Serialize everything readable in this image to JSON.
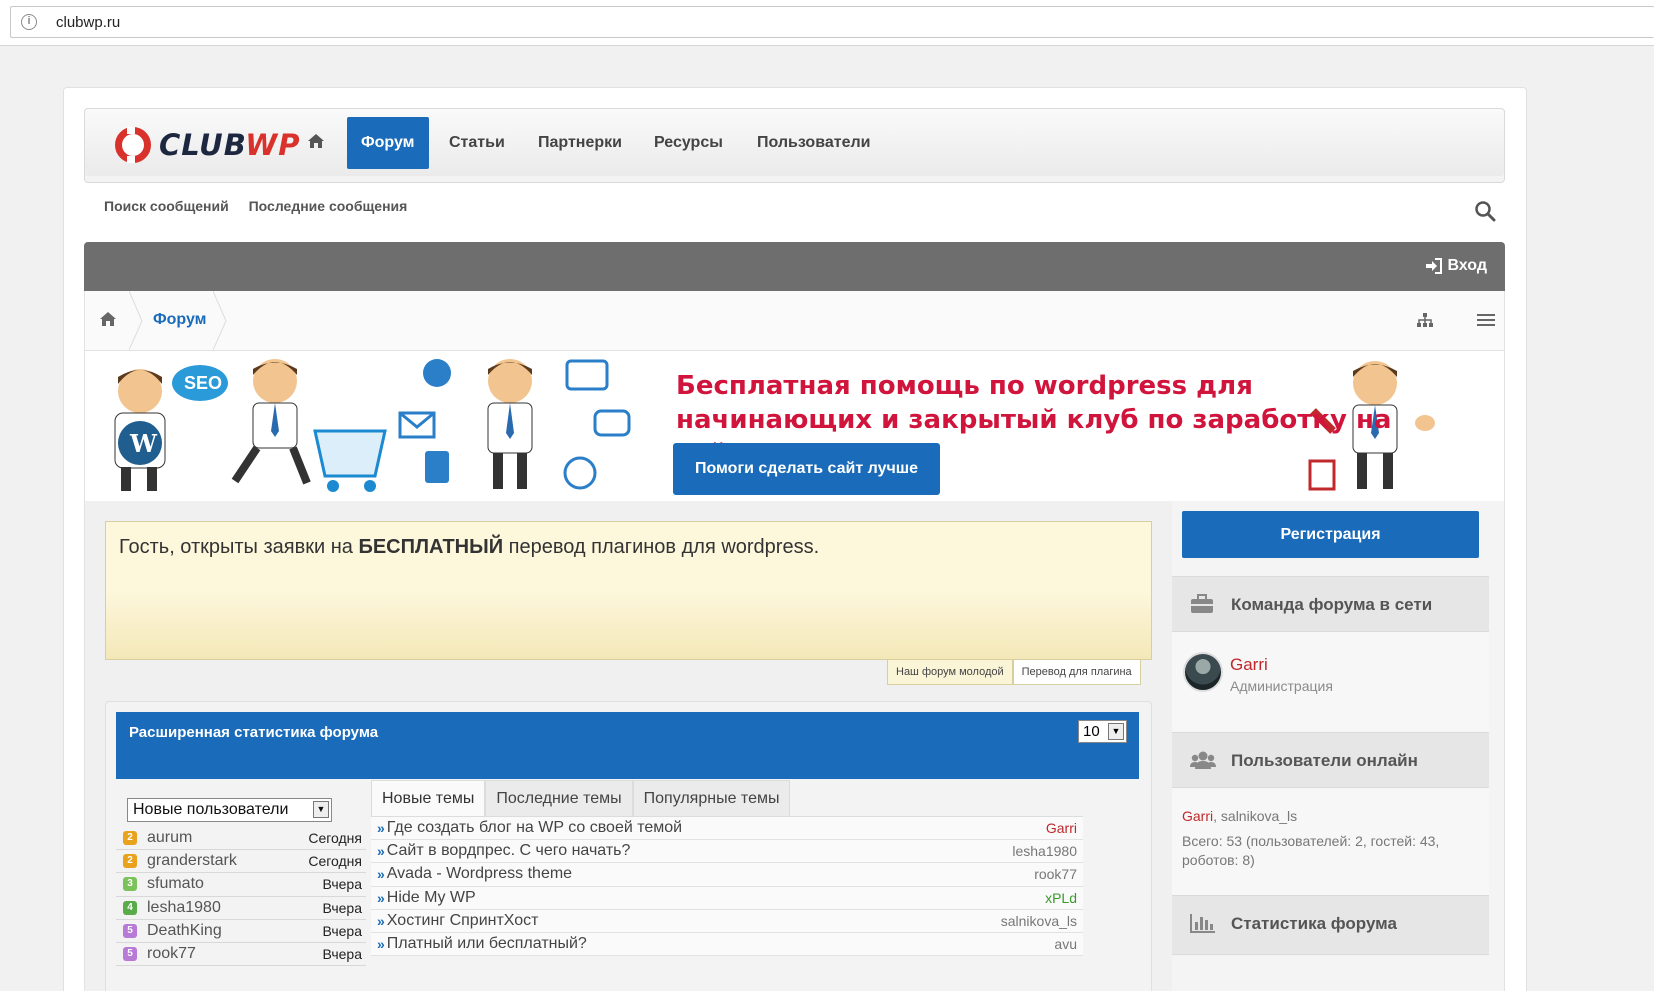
{
  "browser": {
    "url": "clubwp.ru"
  },
  "logo": {
    "part1": "CLUB",
    "part2": "WP"
  },
  "nav": {
    "items": [
      {
        "label": "Форум",
        "active": true
      },
      {
        "label": "Статьи"
      },
      {
        "label": "Партнерки"
      },
      {
        "label": "Ресурсы"
      },
      {
        "label": "Пользователи"
      }
    ]
  },
  "subnav": {
    "search_posts": "Поиск сообщений",
    "latest_posts": "Последние сообщения"
  },
  "login": {
    "label": "Вход"
  },
  "breadcrumb": {
    "forum": "Форум"
  },
  "banner": {
    "text": "Бесплатная помощь по wordpress для начинающих и закрытый клуб по заработку на сайтах",
    "bubble": "SEO",
    "button": "Помоги сделать сайт лучше"
  },
  "notice": {
    "prefix": "Гость, открыты заявки на ",
    "bold": "БЕСПЛАТНЫЙ",
    "suffix": " перевод плагинов для wordpress.",
    "tabs": [
      "Наш форум молодой",
      "Перевод для плагина"
    ]
  },
  "stats": {
    "title": "Расширенная статистика форума",
    "count_select": "10",
    "users_select": "Новые пользователи",
    "users": [
      {
        "name": "aurum",
        "when": "Сегодня",
        "badge": "2",
        "color": "#e8a21d"
      },
      {
        "name": "granderstark",
        "when": "Сегодня",
        "badge": "2",
        "color": "#e8a21d"
      },
      {
        "name": "sfumato",
        "when": "Вчера",
        "badge": "3",
        "color": "#7cc25a"
      },
      {
        "name": "lesha1980",
        "when": "Вчера",
        "badge": "4",
        "color": "#5aab4a"
      },
      {
        "name": "DeathKing",
        "when": "Вчера",
        "badge": "5",
        "color": "#b77ad6"
      },
      {
        "name": "rook77",
        "when": "Вчера",
        "badge": "5",
        "color": "#b77ad6"
      }
    ],
    "topic_tabs": [
      "Новые темы",
      "Последние темы",
      "Популярные темы"
    ],
    "topics": [
      {
        "title": "Где создать блог на WP со своей темой",
        "author": "Garri",
        "color": "#c0282b"
      },
      {
        "title": "Сайт в вордпрес. С чего начать?",
        "author": "lesha1980",
        "color": "#777777"
      },
      {
        "title": "Avada - Wordpress theme",
        "author": "rook77",
        "color": "#777777"
      },
      {
        "title": "Hide My WP",
        "author": "xPLd",
        "color": "#3a9a2a"
      },
      {
        "title": "Хостинг СпринтХост",
        "author": "salnikova_ls",
        "color": "#777777"
      },
      {
        "title": "Платный или бесплатный?",
        "author": "avu",
        "color": "#777777"
      }
    ]
  },
  "sidebar": {
    "register": "Регистрация",
    "staff_title": "Команда форума в сети",
    "staff": {
      "name": "Garri",
      "role": "Администрация"
    },
    "online_title": "Пользователи онлайн",
    "online_user1": "Garri",
    "online_user2": "salnikova_ls",
    "online_total": "Всего: 53 (пользователей: 2, гостей: 43, роботов: 8)",
    "stats_title": "Статистика форума"
  },
  "colors": {
    "accent": "#1a6bb9",
    "banner_text": "#d0143c",
    "login_bar": "#6e6e6e",
    "notice_bg": "#fdf7dc",
    "staff_name": "#c0282b"
  }
}
